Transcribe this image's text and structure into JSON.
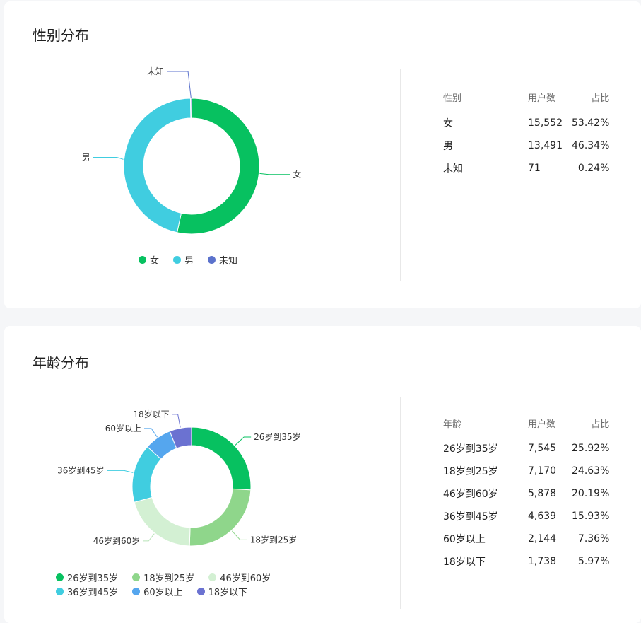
{
  "gender": {
    "title": "性别分布",
    "table": {
      "headers": [
        "性别",
        "用户数",
        "占比"
      ],
      "rows": [
        {
          "name": "女",
          "count": "15,552",
          "pct": "53.42%"
        },
        {
          "name": "男",
          "count": "13,491",
          "pct": "46.34%"
        },
        {
          "name": "未知",
          "count": "71",
          "pct": "0.24%"
        }
      ]
    },
    "legend": [
      {
        "label": "女",
        "color": "#07c160"
      },
      {
        "label": "男",
        "color": "#40cde0"
      },
      {
        "label": "未知",
        "color": "#5b72cc"
      }
    ]
  },
  "age": {
    "title": "年龄分布",
    "table": {
      "headers": [
        "年龄",
        "用户数",
        "占比"
      ],
      "rows": [
        {
          "name": "26岁到35岁",
          "count": "7,545",
          "pct": "25.92%"
        },
        {
          "name": "18岁到25岁",
          "count": "7,170",
          "pct": "24.63%"
        },
        {
          "name": "46岁到60岁",
          "count": "5,878",
          "pct": "20.19%"
        },
        {
          "name": "36岁到45岁",
          "count": "4,639",
          "pct": "15.93%"
        },
        {
          "name": "60岁以上",
          "count": "2,144",
          "pct": "7.36%"
        },
        {
          "name": "18岁以下",
          "count": "1,738",
          "pct": "5.97%"
        }
      ]
    },
    "legend": [
      {
        "label": "26岁到35岁",
        "color": "#07c160"
      },
      {
        "label": "18岁到25岁",
        "color": "#8fd68b"
      },
      {
        "label": "46岁到60岁",
        "color": "#d3f0d3"
      },
      {
        "label": "36岁到45岁",
        "color": "#40cde0"
      },
      {
        "label": "60岁以上",
        "color": "#55a6ee"
      },
      {
        "label": "18岁以下",
        "color": "#6b72d1"
      }
    ]
  },
  "chart_data": [
    {
      "type": "pie",
      "title": "性别分布",
      "categories": [
        "女",
        "男",
        "未知"
      ],
      "values": [
        15552,
        13491,
        71
      ],
      "colors": [
        "#07c160",
        "#40cde0",
        "#5b72cc"
      ],
      "legend_position": "bottom"
    },
    {
      "type": "pie",
      "title": "年龄分布",
      "categories": [
        "26岁到35岁",
        "18岁到25岁",
        "46岁到60岁",
        "36岁到45岁",
        "60岁以上",
        "18岁以下"
      ],
      "values": [
        7545,
        7170,
        5878,
        4639,
        2144,
        1738
      ],
      "colors": [
        "#07c160",
        "#8fd68b",
        "#d3f0d3",
        "#40cde0",
        "#55a6ee",
        "#6b72d1"
      ],
      "legend_position": "bottom"
    }
  ]
}
